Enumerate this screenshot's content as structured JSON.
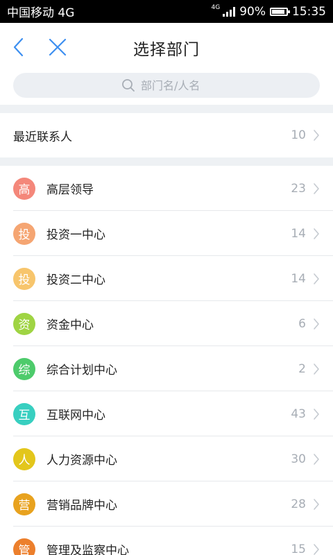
{
  "status_bar": {
    "carrier": "中国移动 4G",
    "network_small": "4G",
    "battery": "90%",
    "battery_level": 0.9,
    "time": "15:35"
  },
  "header": {
    "title": "选择部门",
    "back_icon": "chevron-left-icon",
    "close_icon": "close-icon"
  },
  "search": {
    "placeholder": "部门名/人名",
    "value": ""
  },
  "recent": {
    "label": "最近联系人",
    "count": "10"
  },
  "departments": [
    {
      "badge": "高",
      "name": "高层领导",
      "count": "23",
      "color": "#f4877a"
    },
    {
      "badge": "投",
      "name": "投资一中心",
      "count": "14",
      "color": "#f5a572"
    },
    {
      "badge": "投",
      "name": "投资二中心",
      "count": "14",
      "color": "#f7c56c"
    },
    {
      "badge": "资",
      "name": "资金中心",
      "count": "6",
      "color": "#9fd443"
    },
    {
      "badge": "综",
      "name": "综合计划中心",
      "count": "2",
      "color": "#4dcb6b"
    },
    {
      "badge": "互",
      "name": "互联网中心",
      "count": "43",
      "color": "#38cfc0"
    },
    {
      "badge": "人",
      "name": "人力资源中心",
      "count": "30",
      "color": "#e3c61b"
    },
    {
      "badge": "营",
      "name": "营销品牌中心",
      "count": "28",
      "color": "#e8a21e"
    },
    {
      "badge": "管",
      "name": "管理及监察中心",
      "count": "15",
      "color": "#ec7f2c"
    }
  ],
  "colors": {
    "accent": "#3d8ff0",
    "muted": "#a7adb5",
    "band": "#eef1f4"
  }
}
